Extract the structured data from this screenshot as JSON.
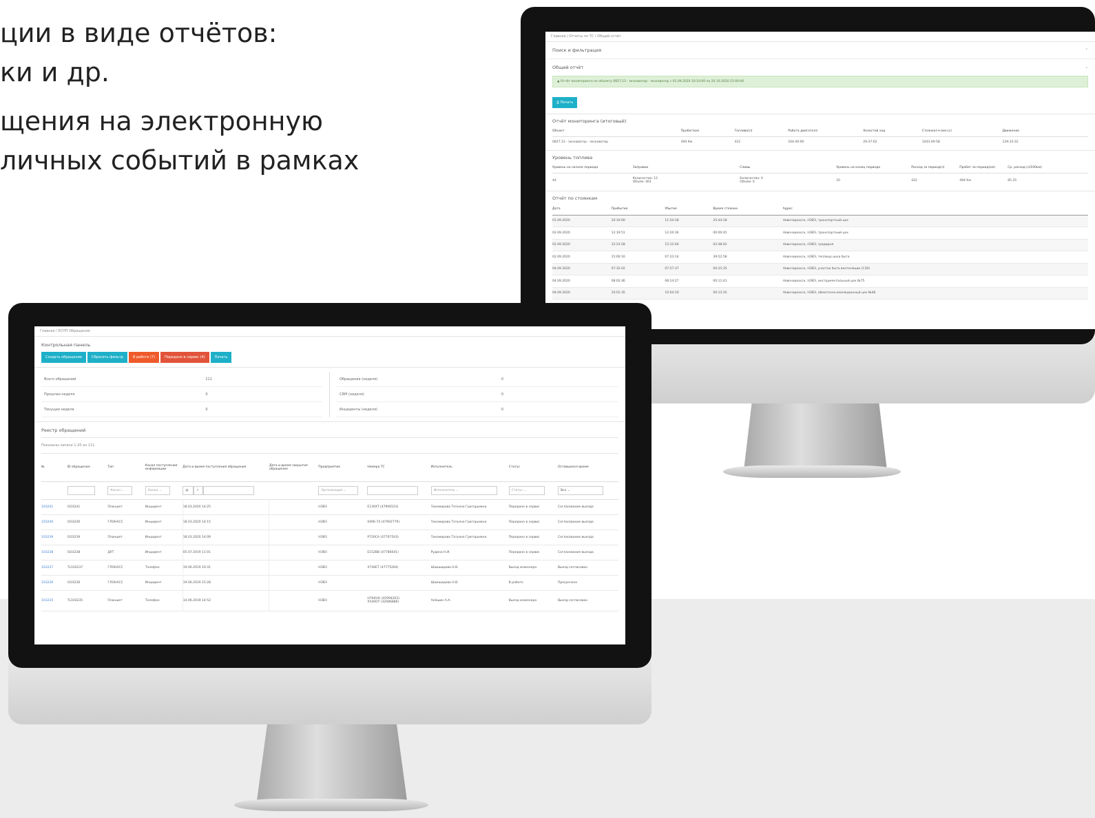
{
  "slide": {
    "lines": [
      "ции в виде отчётов:",
      "ки и др.",
      "щения на электронную",
      "личных событий в рамках"
    ]
  },
  "report": {
    "breadcrumb": "Главная / Отчеты по ТС / Общий отчёт",
    "search_label": "Поиск и фильтрация",
    "general_label": "Общий отчёт",
    "alert": "Отчёт мониторинга по объекту 0827.13 - экскаватор - экскаватор с 01.09.2020 10:10:00 по 20.10.2020 23:00:00",
    "print": "Печать",
    "summary_title": "Отчёт мониторинга (итоговый)",
    "summary_cols": [
      "Объект",
      "Пробег(км)",
      "Топливо(л)",
      "Работа двигателя",
      "Холостой ход",
      "Стоянка(чч:мм:сс)",
      "Движение"
    ],
    "summary_row": [
      "0827.13 - экскаватор - экскаватор",
      "494 Км",
      "422",
      "164:40:00",
      "29:37:02",
      "1043:49:58",
      "129:33:32"
    ],
    "fuel_title": "Уровень топлива",
    "fuel_cols": [
      "Уровень на начало периода",
      "Заправки",
      "Сливы",
      "Уровень на конец периода",
      "Расход за период(л)",
      "Пробег за период(км)",
      "Ср. расход (л/100км)"
    ],
    "fuel_row": [
      "44",
      "Количество: 12\nОбъём: 401",
      "Количество: 0\nОбъём: 0",
      "10",
      "422",
      "494 Км",
      "85.35"
    ],
    "stops_title": "Отчёт по стоянкам",
    "stops_cols": [
      "Дата",
      "Прибытие",
      "Убытие",
      "Время стоянки",
      "Адрес"
    ],
    "stops_rows": [
      [
        "01.09.2020",
        "10:10:00",
        "11:54:18",
        "25:44:18",
        "Новочеркасск, НЭВЗ, транспортный цех"
      ],
      [
        "02.09.2020",
        "12:19:51",
        "12:20:36",
        "00:00:45",
        "Новочеркасск, НЭВЗ, транспортный цех"
      ],
      [
        "02.09.2020",
        "12:23:58",
        "15:12:40",
        "02:48:42",
        "Новочеркасск, НЭВЗ, градирня"
      ],
      [
        "02.09.2020",
        "15:00:16",
        "07:23:14",
        "39:52:58",
        "Новочеркасск, НЭВЗ, теплица цеха быта"
      ],
      [
        "04.09.2020",
        "07:32:02",
        "07:57:37",
        "00:25:35",
        "Новочеркасск, НЭВЗ, участок быта вентиляции (С30)"
      ],
      [
        "04.09.2020",
        "08:02:46",
        "08:14:27",
        "00:11:41",
        "Новочеркасск, НЭВЗ, инструментальный цех №75"
      ],
      [
        "04.09.2020",
        "10:01:35",
        "10:04:10",
        "00:13:35",
        "Новочеркасск, НЭВЗ, обмоточно-изоляционный цех №48"
      ]
    ]
  },
  "requests": {
    "breadcrumb": "Главная / ЕСПП Обращения",
    "control_title": "Контрольная панель",
    "buttons": [
      "Создать обращение",
      "Сбросить фильтр",
      "В работе (7)",
      "Передано в сервис (4)",
      "Печать"
    ],
    "stats_left": [
      [
        "Всего обращений",
        "111"
      ],
      [
        "Прошлая неделя",
        "0"
      ],
      [
        "Текущая неделя",
        "0"
      ]
    ],
    "stats_right": [
      [
        "Обращения (неделя)",
        "0"
      ],
      [
        "CRM (неделя)",
        "0"
      ],
      [
        "Инциденты (неделя)",
        "0"
      ]
    ],
    "registry_title": "Реестр обращений",
    "shown": "Показаны записи 1-20 из 111.",
    "cols": [
      "№",
      "ID обращения",
      "Тип",
      "Канал поступления информации",
      "Дата и время поступления обращения",
      "Дата и время закрытия обращения",
      "Предприятие",
      "Номера ТС",
      "Исполнитель",
      "Статус",
      "Оставшееся время"
    ],
    "filters": {
      "kanal1": "Канал",
      "kanal2": "Канал",
      "org": "Организация",
      "exec": "Исполнитель",
      "status": "Статус",
      "all": "Все"
    },
    "rows": [
      [
        "103241",
        "I103241",
        "Планшет",
        "Инцидент",
        "18.03.2020 14:25",
        "",
        "НЭВЗ",
        "Е130XT (47906523)",
        "Тихомирова Татьяна Григорьевна",
        "Передано в сервис",
        "Согласование выезда"
      ],
      [
        "103240",
        "I103240",
        "ГЛОНАСС",
        "Инцидент",
        "18.03.2020 14:15",
        "",
        "НЭВЗ",
        "0496-74 (47902779)",
        "Тихомирова Татьяна Григорьевна",
        "Передано в сервис",
        "Согласование выезда"
      ],
      [
        "103239",
        "I103239",
        "Планшет",
        "Инцидент",
        "18.03.2020 14:09",
        "",
        "НЭВЗ",
        "Р720СА (47767543)",
        "Тихомирова Татьяна Григорьевна",
        "Передано в сервис",
        "Согласование выезда"
      ],
      [
        "103238",
        "I103238",
        "ДУТ",
        "Инцидент",
        "05.07.2019 11:01",
        "",
        "НЭВЗ",
        "Е152ВВ (47786041)",
        "Рудина Н.И.",
        "Передано в сервис",
        "Согласование выезда"
      ],
      [
        "103237",
        "TL103237",
        "ГЛОНАСС",
        "Телефон",
        "19.06.2019 10:31",
        "",
        "НЭВЗ",
        "Х746ЕТ (47775264)",
        "Шамшидова Н.В.",
        "Выезд инженера",
        "Выезд согласован"
      ],
      [
        "103236",
        "I103236",
        "ГЛОНАСС",
        "Инцидент",
        "19.06.2019 15:28",
        "",
        "НЭВЗ",
        "",
        "Шамшидова Н.В.",
        "В работе",
        "Просрочено"
      ],
      [
        "103235",
        "TL103235",
        "Планшет",
        "Телефон",
        "14.06.2019 14:52",
        "",
        "НЭВЗ",
        "Н760НН (45994263)\nХ540ОТ (32086886)",
        "Алёшин А.А.",
        "Выезд инженера",
        "Выезд согласован"
      ]
    ]
  }
}
